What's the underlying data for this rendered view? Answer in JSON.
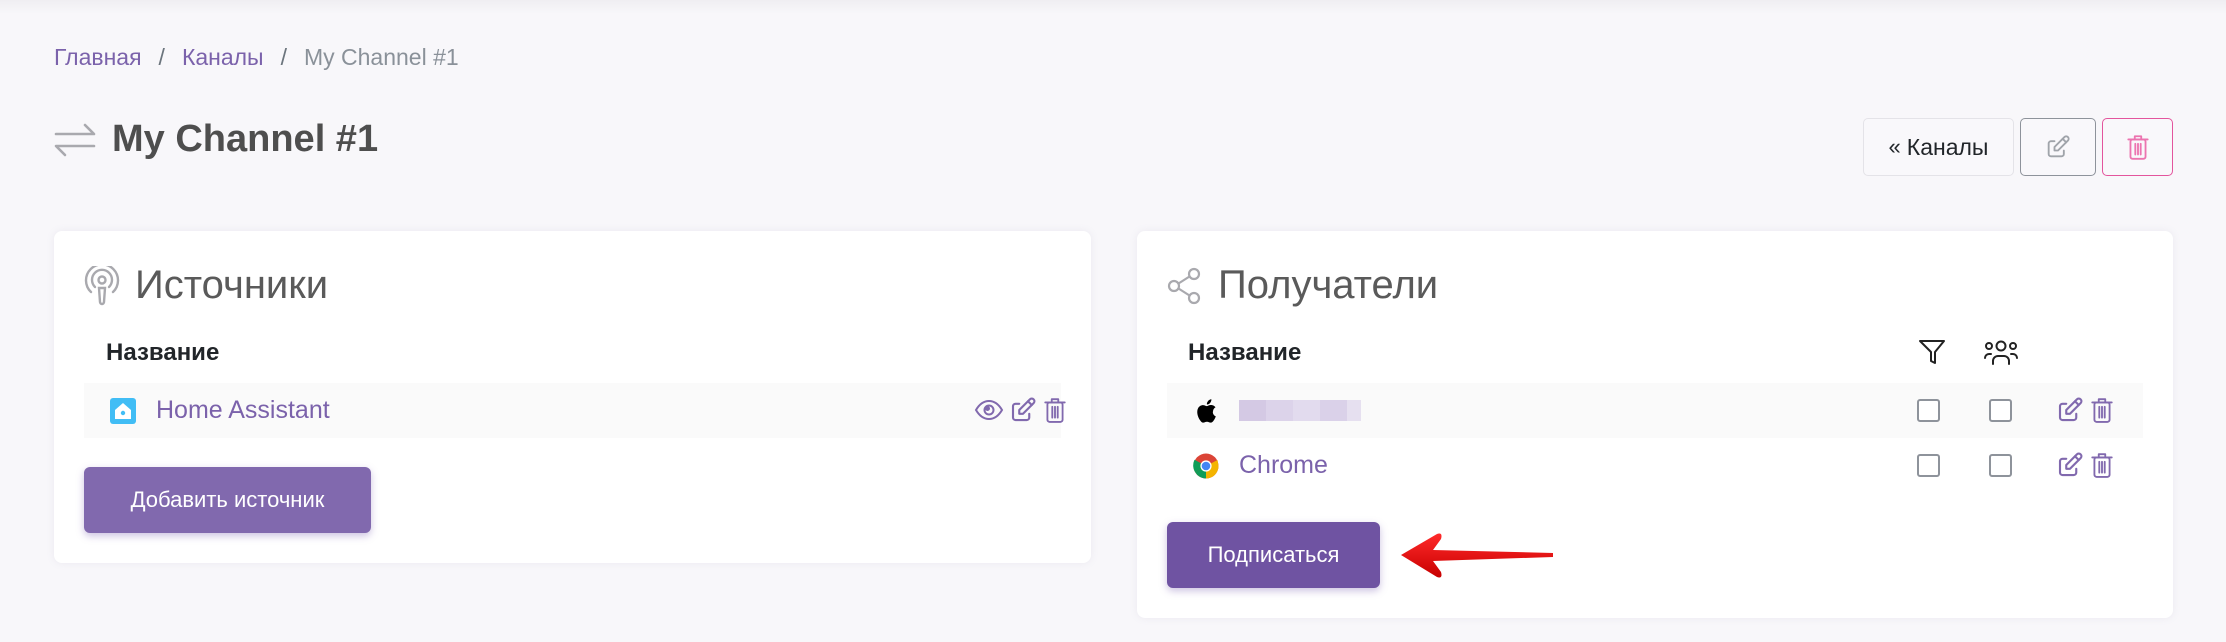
{
  "breadcrumb": {
    "items": [
      {
        "label": "Главная",
        "link": true
      },
      {
        "label": "Каналы",
        "link": true
      },
      {
        "label": "My Channel #1",
        "link": false
      }
    ],
    "separator": "/"
  },
  "header": {
    "title": "My Channel #1",
    "title_icon": "arrows-exchange-icon",
    "back_button": {
      "chevron": "«",
      "label": "Каналы"
    },
    "edit_button_icon": "edit-icon",
    "delete_button_icon": "trash-icon"
  },
  "sources": {
    "title": "Источники",
    "title_icon": "podcast-icon",
    "column_name": "Название",
    "rows": [
      {
        "name": "Home Assistant",
        "icon": "home-assistant-icon",
        "actions": [
          "view",
          "edit",
          "delete"
        ]
      }
    ],
    "add_button": "Добавить источник"
  },
  "recipients": {
    "title": "Получатели",
    "title_icon": "share-icon",
    "column_name": "Название",
    "column_filter_icon": "filter-icon",
    "column_group_icon": "users-group-icon",
    "rows": [
      {
        "name": "",
        "name_redacted": true,
        "icon": "apple-icon",
        "filter": false,
        "group": false
      },
      {
        "name": "Chrome",
        "name_redacted": false,
        "icon": "chrome-icon",
        "filter": false,
        "group": false
      }
    ],
    "subscribe_button": "Подписаться"
  },
  "annotation": {
    "type": "red-arrow",
    "points_to": "subscribe-button",
    "color": "#e00000"
  },
  "colors": {
    "accent": "#7b62ab",
    "primary_button": "#8169ae",
    "primary_button_dark": "#6f53a2",
    "danger": "#e3559d",
    "background": "#f8f7fa"
  }
}
